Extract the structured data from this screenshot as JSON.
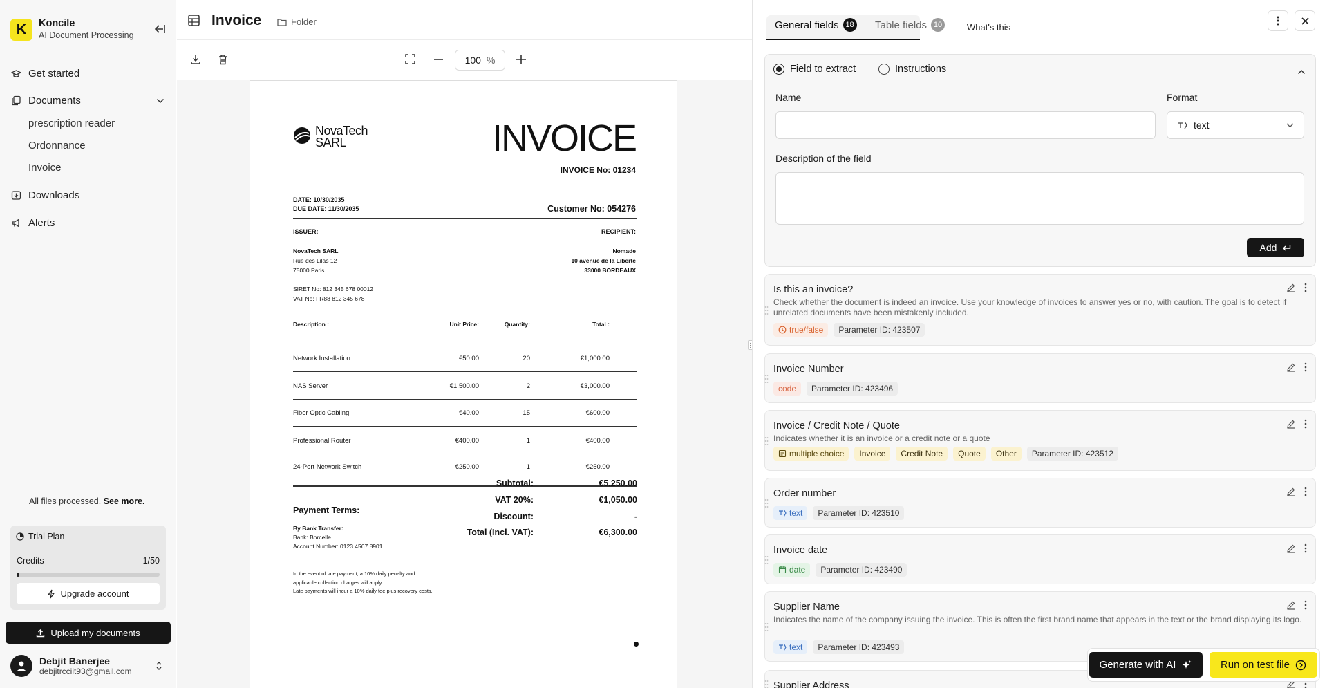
{
  "sidebar": {
    "brand": {
      "letter": "K",
      "name": "Koncile",
      "subtitle": "AI Document Processing"
    },
    "nav": [
      {
        "label": "Get started",
        "icon": "graduation-cap-icon"
      },
      {
        "label": "Documents",
        "icon": "documents-icon"
      },
      {
        "label": "Downloads",
        "icon": "download-box-icon"
      },
      {
        "label": "Alerts",
        "icon": "megaphone-icon"
      }
    ],
    "documents": [
      "prescription reader",
      "Ordonnance",
      "Invoice"
    ],
    "status_text": "All files processed.",
    "status_link": "See more.",
    "plan": {
      "name": "Trial Plan",
      "credits_label": "Credits",
      "credits_value": "1/50",
      "credits_fraction": 0.02,
      "upgrade": "Upgrade account"
    },
    "upload": "Upload my documents",
    "user": {
      "name": "Debjit Banerjee",
      "email": "debjitrcciit93@gmail.com"
    }
  },
  "center": {
    "title": "Invoice",
    "folder": "Folder",
    "zoom": "100",
    "zoom_unit": "%"
  },
  "invoice": {
    "logo_line1": "NovaTech",
    "logo_line2": "SARL",
    "heading": "INVOICE",
    "number": "INVOICE No: 01234",
    "date": "DATE: 10/30/2035",
    "due_date": "DUE DATE: 11/30/2035",
    "customer": "Customer No: 054276",
    "issuer_label": "ISSUER:",
    "recipient_label": "RECIPIENT:",
    "issuer": [
      "NovaTech SARL",
      "Rue des Lilas 12",
      "75000 Paris"
    ],
    "recipient": [
      "Nomade",
      "10 avenue de la Liberté",
      "33000 BORDEAUX"
    ],
    "siret": "SIRET No: 812 345 678 00012",
    "vat_no": "VAT No: FR88 812 345 678",
    "columns": [
      "Description :",
      "Unit Price:",
      "Quantity:",
      "Total :"
    ],
    "rows": [
      [
        "Network Installation",
        "€50.00",
        "20",
        "€1,000.00"
      ],
      [
        "NAS Server",
        "€1,500.00",
        "2",
        "€3,000.00"
      ],
      [
        "Fiber Optic Cabling",
        "€40.00",
        "15",
        "€600.00"
      ],
      [
        "Professional Router",
        "€400.00",
        "1",
        "€400.00"
      ],
      [
        "24-Port Network Switch",
        "€250.00",
        "1",
        "€250.00"
      ]
    ],
    "totals": [
      [
        "Subtotal:",
        "€5,250.00"
      ],
      [
        "VAT 20%:",
        "€1,050.00"
      ],
      [
        "Discount:",
        "-"
      ],
      [
        "Total (Incl. VAT):",
        "€6,300.00"
      ]
    ],
    "payment_title": "Payment Terms:",
    "payment_lines": [
      "By Bank Transfer:",
      "Bank: Borcelle",
      "Account Number: 0123 4567 8901"
    ],
    "late_lines": [
      "In the event of late payment, a 10% daily penalty and",
      "applicable collection charges will apply.",
      "Late payments will incur a 10% daily fee plus recovery costs."
    ]
  },
  "right": {
    "tabs": [
      {
        "label": "General fields",
        "count": "18"
      },
      {
        "label": "Table fields",
        "count": "10"
      },
      {
        "label": "What's this"
      }
    ],
    "form": {
      "radio_extract": "Field to extract",
      "radio_instructions": "Instructions",
      "name_label": "Name",
      "format_label": "Format",
      "format_value": "text",
      "desc_label": "Description of the field",
      "add": "Add"
    },
    "fields": [
      {
        "title": "Is this an invoice?",
        "desc": "Check whether the document is indeed an invoice. Use your knowledge of invoices to answer yes or no, with caution. The goal is to detect if unrelated documents have been mistakenly included.",
        "type": "true/false",
        "param": "Parameter ID: 423507",
        "options": []
      },
      {
        "title": "Invoice Number",
        "desc": "",
        "type": "code",
        "param": "Parameter ID: 423496",
        "options": []
      },
      {
        "title": "Invoice / Credit Note / Quote",
        "desc": "Indicates whether it is an invoice or a credit note or a quote",
        "type": "multiple choice",
        "param": "Parameter ID: 423512",
        "options": [
          "Invoice",
          "Credit Note",
          "Quote",
          "Other"
        ]
      },
      {
        "title": "Order number",
        "desc": "",
        "type": "text",
        "param": "Parameter ID: 423510",
        "options": []
      },
      {
        "title": "Invoice date",
        "desc": "",
        "type": "date",
        "param": "Parameter ID: 423490",
        "options": []
      },
      {
        "title": "Supplier Name",
        "desc": "Indicates the name of the company issuing the invoice. This is often the first brand name that appears in the text or the brand displaying its logo.",
        "type": "text",
        "param": "Parameter ID: 423493",
        "options": []
      },
      {
        "title": "Supplier Address",
        "desc": "",
        "type": "",
        "param": "",
        "options": []
      }
    ],
    "generate": "Generate with AI",
    "run": "Run on test file"
  }
}
